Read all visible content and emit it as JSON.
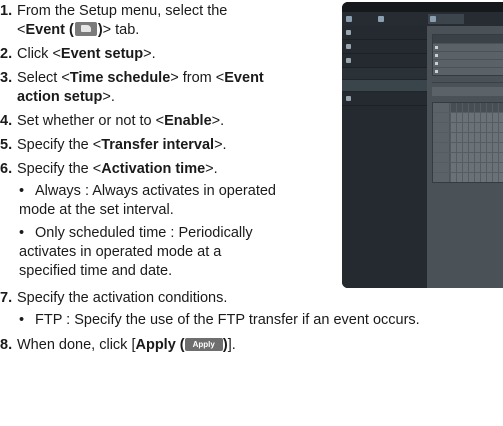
{
  "steps": [
    {
      "num": "1.",
      "pre": "From the Setup menu, select the",
      "line2_pre": "<",
      "bold": "Event (",
      "bold_close": ")",
      "post": "> tab."
    },
    {
      "num": "2.",
      "pre": "Click <",
      "bold": "Event setup",
      "post": ">."
    },
    {
      "num": "3.",
      "pre": "Select <",
      "bold": "Time schedule",
      "mid": "> from <",
      "bold2": "Event",
      "line2_bold": "action setup",
      "post": ">."
    },
    {
      "num": "4.",
      "pre": "Set whether or not to <",
      "bold": "Enable",
      "post": ">."
    },
    {
      "num": "5.",
      "pre": "Specify the <",
      "bold": "Transfer interval",
      "post": ">."
    },
    {
      "num": "6.",
      "pre": "Specify the <",
      "bold": "Activation time",
      "post": ">."
    },
    {
      "num": "7.",
      "text": "Specify the activation conditions."
    },
    {
      "num": "8.",
      "pre": "When done, click [",
      "bold": "Apply (",
      "bold_close": ")",
      "post": "]."
    }
  ],
  "bullets": {
    "always": [
      "Always : Always activates in operated",
      "mode at the set interval."
    ],
    "scheduled": [
      "Only scheduled time : Periodically",
      "activates in operated mode at a",
      "specified time and date."
    ],
    "ftp": "FTP : Specify the use of the FTP transfer if an event occurs."
  },
  "apply_button": "Apply",
  "bullet_char": "•",
  "icons": {
    "event_tab": "event-folder-icon"
  }
}
